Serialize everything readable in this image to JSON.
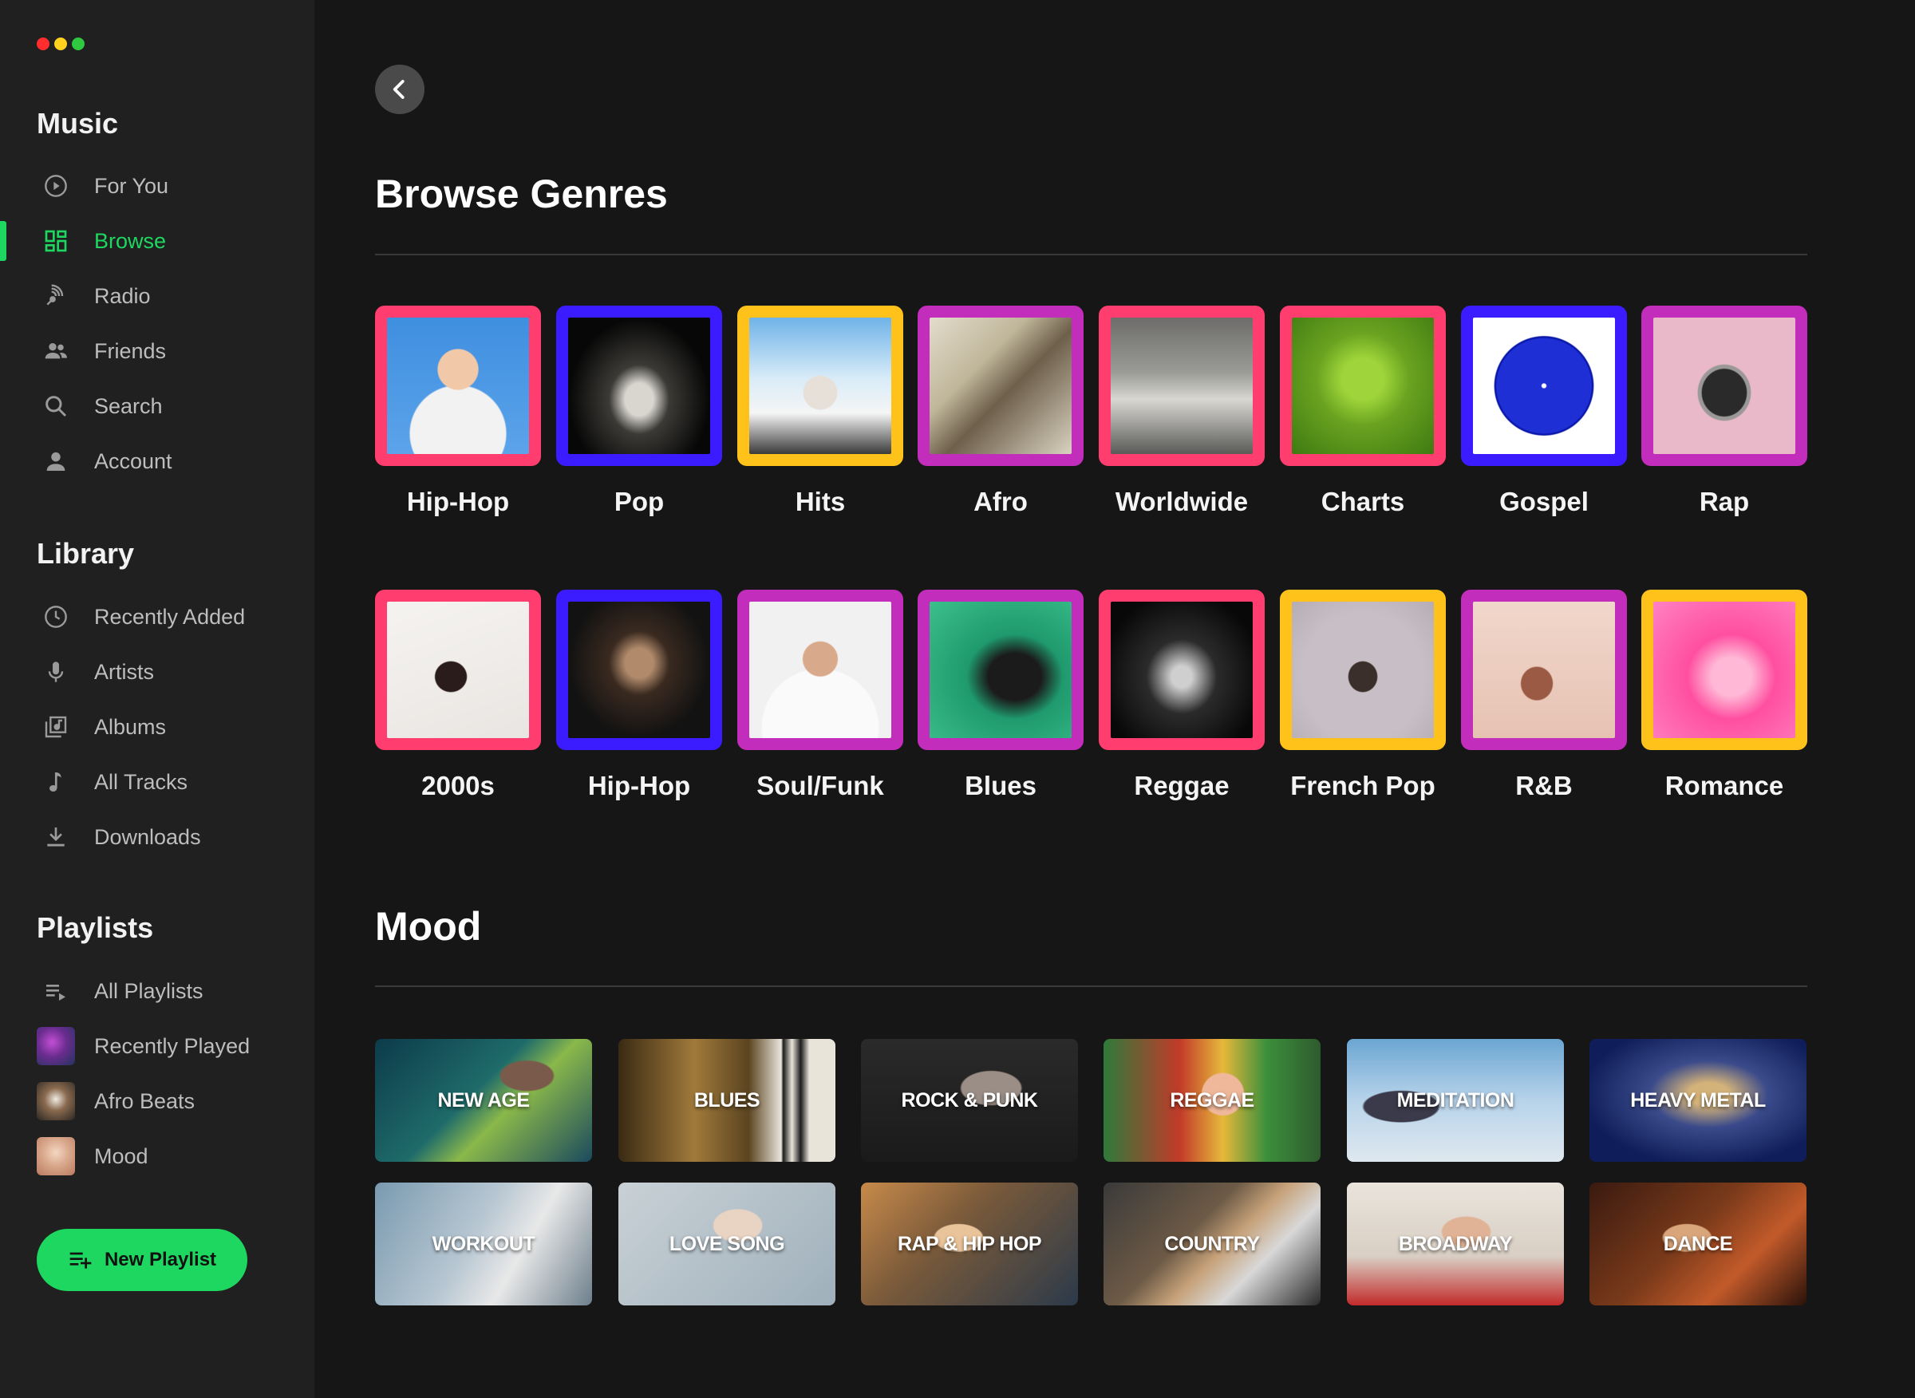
{
  "window": {
    "controls": [
      "#ff3b30",
      "#ffcc00",
      "#28c840"
    ]
  },
  "sidebar": {
    "music_title": "Music",
    "music_items": [
      {
        "label": "For You",
        "icon": "play-circle-icon"
      },
      {
        "label": "Browse",
        "icon": "grid-icon",
        "active": true
      },
      {
        "label": "Radio",
        "icon": "radio-icon"
      },
      {
        "label": "Friends",
        "icon": "friends-icon"
      },
      {
        "label": "Search",
        "icon": "search-icon"
      },
      {
        "label": "Account",
        "icon": "account-icon"
      }
    ],
    "library_title": "Library",
    "library_items": [
      {
        "label": "Recently Added",
        "icon": "clock-icon"
      },
      {
        "label": "Artists",
        "icon": "microphone-icon"
      },
      {
        "label": "Albums",
        "icon": "album-icon"
      },
      {
        "label": "All Tracks",
        "icon": "music-note-icon"
      },
      {
        "label": "Downloads",
        "icon": "download-icon"
      }
    ],
    "playlists_title": "Playlists",
    "playlist_items": [
      {
        "label": "All Playlists",
        "icon": "playlist-icon"
      },
      {
        "label": "Recently Played",
        "icon": "playlist-thumbnail"
      },
      {
        "label": "Afro Beats",
        "icon": "playlist-thumbnail"
      },
      {
        "label": "Mood",
        "icon": "playlist-thumbnail"
      }
    ],
    "new_playlist_label": "New Playlist"
  },
  "main": {
    "back_icon": "chevron-left-icon",
    "genres_title": "Browse Genres",
    "genres": [
      {
        "label": "Hip-Hop",
        "frame": "#ff3d6e"
      },
      {
        "label": "Pop",
        "frame": "#3b1bff"
      },
      {
        "label": "Hits",
        "frame": "#ffc21a"
      },
      {
        "label": "Afro",
        "frame": "#c22dbb"
      },
      {
        "label": "Worldwide",
        "frame": "#ff3d6e"
      },
      {
        "label": "Charts",
        "frame": "#ff3d6e"
      },
      {
        "label": "Gospel",
        "frame": "#3b1bff"
      },
      {
        "label": "Rap",
        "frame": "#c22dbb"
      },
      {
        "label": "2000s",
        "frame": "#ff3d6e"
      },
      {
        "label": "Hip-Hop",
        "frame": "#3b1bff"
      },
      {
        "label": "Soul/Funk",
        "frame": "#c22dbb"
      },
      {
        "label": "Blues",
        "frame": "#c22dbb"
      },
      {
        "label": "Reggae",
        "frame": "#ff3d6e"
      },
      {
        "label": "French Pop",
        "frame": "#ffc21a"
      },
      {
        "label": "R&B",
        "frame": "#c22dbb"
      },
      {
        "label": "Romance",
        "frame": "#ffc21a"
      }
    ],
    "mood_title": "Mood",
    "moods": [
      "NEW AGE",
      "BLUES",
      "ROCK & PUNK",
      "REGGAE",
      "MEDITATION",
      "HEAVY METAL",
      "WORKOUT",
      "LOVE SONG",
      "RAP & HIP HOP",
      "COUNTRY",
      "BROADWAY",
      "DANCE"
    ]
  }
}
